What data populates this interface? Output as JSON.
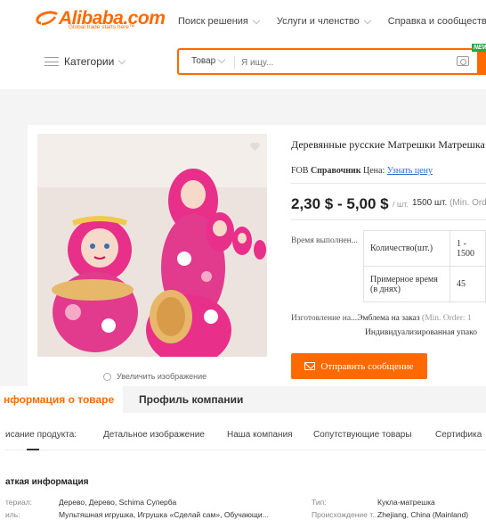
{
  "header": {
    "logo": "Alibaba.com",
    "logo_tagline": "Global trade starts here™",
    "nav": [
      "Поиск решения",
      "Услуги и членство",
      "Справка и сообщество"
    ],
    "categories": "Категории",
    "search_type": "Товар",
    "search_placeholder": "Я ищу...",
    "new_badge": "NEW"
  },
  "colors": {
    "accent": "#ff6a00",
    "link": "#2a6ecf",
    "badge": "#28a745"
  },
  "product": {
    "title": "Деревянные русские Матрешки Матрешка д",
    "fob_label": "FOB",
    "fob_ref": "Справочник",
    "fob_price_label": "Цена:",
    "fob_link": "Узнать цену",
    "price": "2,30 $ - 5,00 $",
    "price_unit": "/ шт.",
    "moq": "1500 шт.",
    "moq_note": "(Min. Ord",
    "lead_label": "Время выполнен...",
    "lead_table": [
      [
        "Количество(шт.)",
        "1 - 1500"
      ],
      [
        "Примерное время (в днях)",
        "45"
      ]
    ],
    "custom_label": "Изготовление на...",
    "custom_value": "Эмблема на заказ",
    "custom_note": "(Min. Order: 1",
    "custom_value2": "Индивидуализированная упако",
    "send_button": "Отправить сообщение",
    "zoom_label": "Увеличить изображение"
  },
  "tabs": [
    "нформация о товаре",
    "Профиль компании"
  ],
  "subnav": [
    "исание продукта:",
    "Детальное изображение",
    "Наша компания",
    "Сопутствующие товары",
    "Сертифика"
  ],
  "brief": {
    "title": "аткая информация",
    "rows": [
      {
        "k1": "териал:",
        "v1": "Дерево, Дерево, Schima Суперба",
        "k2": "Тип:",
        "v2": "Кукла-матрешка"
      },
      {
        "k1": "иль:",
        "v1": "Мультяшная игрушка, Игрушка «Сделай сам», Обучающи...",
        "k2": "Происхождение т...",
        "v2": "Zhejiang, China (Mainland)"
      }
    ]
  }
}
